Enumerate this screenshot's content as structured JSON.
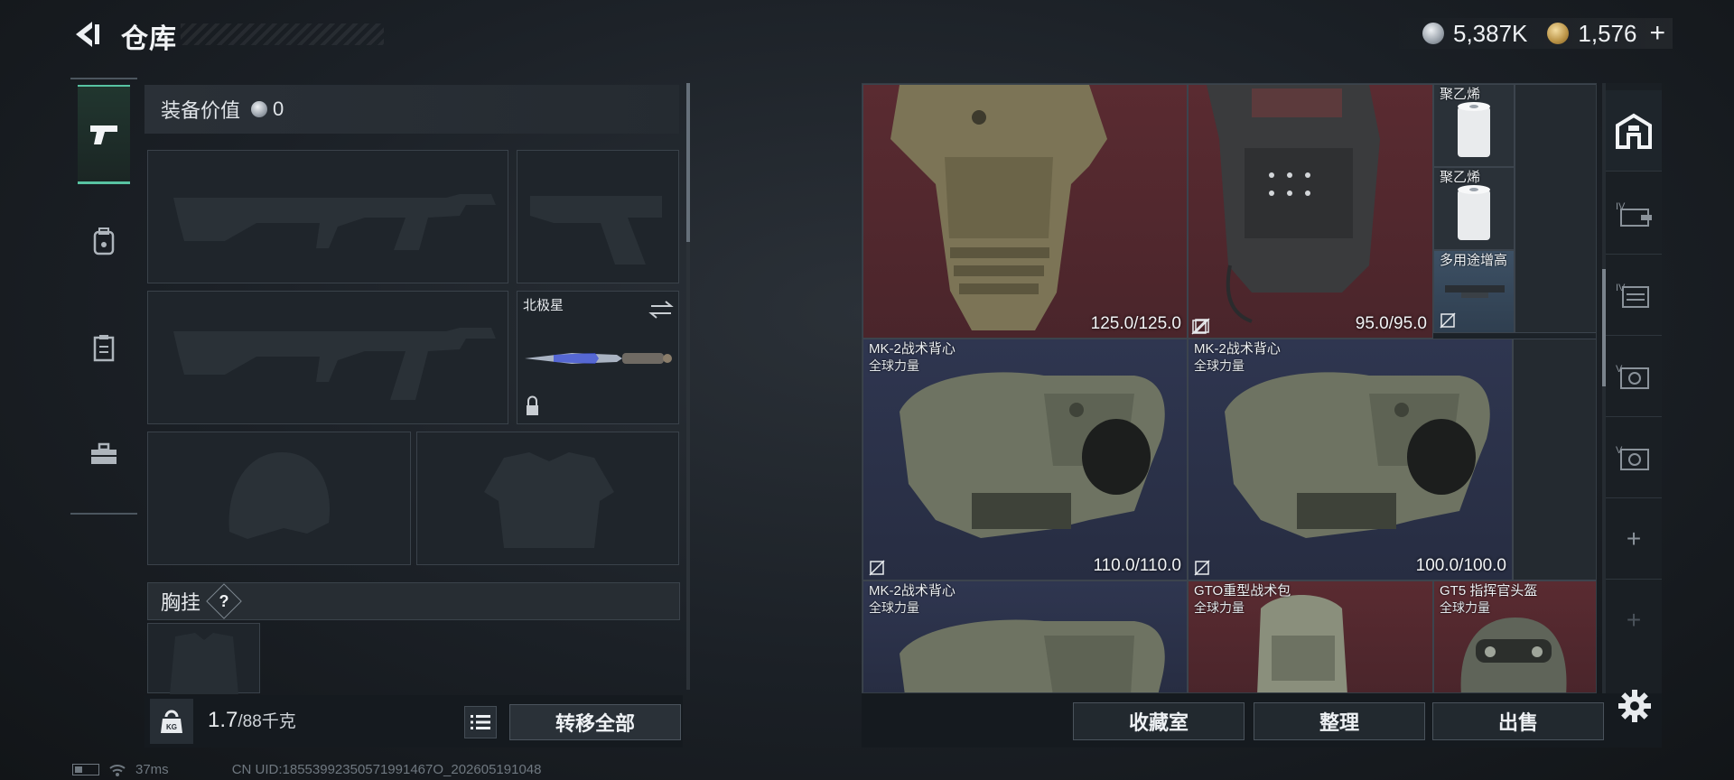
{
  "header": {
    "title": "仓库",
    "silver_amount": "5,387K",
    "gold_amount": "1,576",
    "gold_plus": "+"
  },
  "left_tabs": [
    {
      "icon": "pistol-icon",
      "active": true
    },
    {
      "icon": "backpack-icon",
      "active": false
    },
    {
      "icon": "clipboard-icon",
      "active": false
    },
    {
      "icon": "toolbox-icon",
      "active": false
    }
  ],
  "equipment": {
    "value_label": "装备价值",
    "value": "0",
    "melee_name": "北极星",
    "chest_rig_label": "胸挂",
    "help_mark": "?"
  },
  "bottom_left": {
    "weight_current": "1.7",
    "weight_max": "/88千克",
    "transfer_all_label": "转移全部"
  },
  "status": {
    "ping": "37ms",
    "uid": "CN UID:18553992350571991467O_202605191048"
  },
  "stash_items": [
    {
      "id": "vest-1",
      "name": "",
      "sub": "",
      "durability": "125.0/125.0",
      "bg": "red"
    },
    {
      "id": "vest-2",
      "name": "",
      "sub": "",
      "durability": "95.0/95.0",
      "bg": "red"
    },
    {
      "id": "poly-1",
      "name": "聚乙烯",
      "sub": "",
      "durability": "",
      "bg": "grey"
    },
    {
      "id": "poly-2",
      "name": "聚乙烯",
      "sub": "",
      "durability": "",
      "bg": "grey"
    },
    {
      "id": "multi",
      "name": "多用途增高",
      "sub": "",
      "durability": "",
      "bg": "blue"
    },
    {
      "id": "mk2-a",
      "name": "MK-2战术背心",
      "sub": "全球力量",
      "durability": "110.0/110.0",
      "bg": "navy"
    },
    {
      "id": "mk2-b",
      "name": "MK-2战术背心",
      "sub": "全球力量",
      "durability": "100.0/100.0",
      "bg": "navy"
    },
    {
      "id": "mk2-c",
      "name": "MK-2战术背心",
      "sub": "全球力量",
      "durability": "",
      "bg": "navy"
    },
    {
      "id": "gto",
      "name": "GTO重型战术包",
      "sub": "全球力量",
      "durability": "",
      "bg": "red"
    },
    {
      "id": "gt5",
      "name": "GT5 指挥官头盔",
      "sub": "全球力量",
      "durability": "",
      "bg": "red"
    }
  ],
  "stash_tabs": [
    {
      "icon": "stash-home-icon",
      "label": ""
    },
    {
      "icon": "case-iv-icon",
      "label": "IV"
    },
    {
      "icon": "case-iv-2-icon",
      "label": "IV"
    },
    {
      "icon": "safe-v-icon",
      "label": "V"
    },
    {
      "icon": "safe-v-2-icon",
      "label": "V"
    },
    {
      "icon": "add-icon",
      "label": "+"
    },
    {
      "icon": "add-locked-icon",
      "label": "+"
    }
  ],
  "actions": {
    "collection_label": "收藏室",
    "sort_label": "整理",
    "sell_label": "出售"
  }
}
